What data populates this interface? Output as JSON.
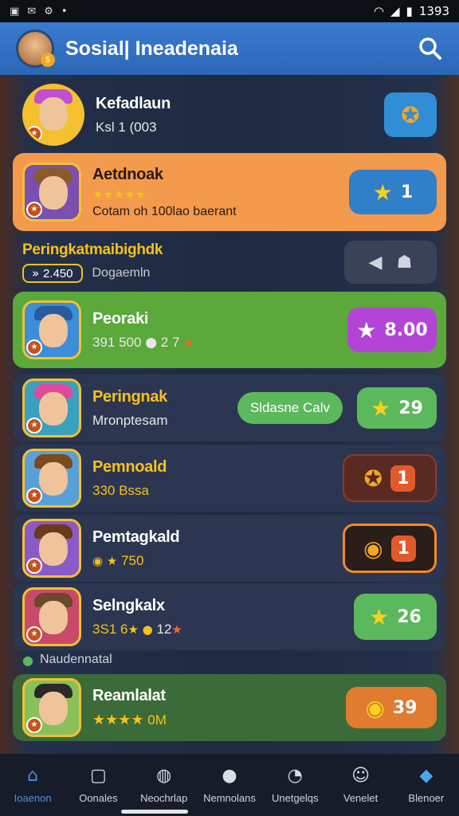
{
  "status_bar": {
    "time": "1393",
    "icons": [
      "image-icon",
      "mail-icon",
      "settings-icon",
      "dot-icon"
    ]
  },
  "header": {
    "title": "Sosial| Ineadenaia"
  },
  "profile": {
    "name": "Kefadlaun",
    "sub": "Ksl 1 (003"
  },
  "highlight": {
    "name": "Aetdnoak",
    "stars": "★★★★★",
    "sub": "Cotam oh 100lao baerant",
    "badge": "1",
    "colors": {
      "bg": "#f39a4d",
      "pill": "#2f7fc9"
    }
  },
  "section": {
    "title": "Peringkatmaibighdk",
    "score": "2.450",
    "sub": "Dogaemln"
  },
  "rows": [
    {
      "name": "Peoraki",
      "sub": "391 500",
      "extra": "2 7",
      "pill": "8.00",
      "bg": "#5aa93a",
      "pill_bg": "#b344d6"
    },
    {
      "name": "Peringnak",
      "sub": "Mronptesam",
      "tag": "Sldasne Calv",
      "pill": "29",
      "bg": "#2c3650",
      "pill_bg": "#5cb85c"
    },
    {
      "name": "Pemnoald",
      "sub": "330 Bssa",
      "pill": "1",
      "bg": "#2c3650",
      "pill_bg": "#5a2a22"
    },
    {
      "name": "Pemtagkald",
      "sub": "750",
      "pill": "1",
      "bg": "#2c3650",
      "pill_bg": "#2a1d1a"
    },
    {
      "name": "Selngkalx",
      "sub": "3S1 6",
      "extra": "12",
      "pill": "26",
      "bg": "#2c3650",
      "pill_bg": "#5cb85c"
    }
  ],
  "partial_row": {
    "text": "Naudennatal"
  },
  "last_row": {
    "name": "Reamlalat",
    "stars": "★★★★",
    "sub": "0M",
    "pill": "39",
    "bg": "#3c6b3a",
    "pill_bg": "#e07b30"
  },
  "nav": [
    {
      "label": "Ioaenon",
      "icon": "home-icon"
    },
    {
      "label": "Oonales",
      "icon": "square-icon"
    },
    {
      "label": "Neochrlap",
      "icon": "globe-icon"
    },
    {
      "label": "Nemnolans",
      "icon": "group-icon"
    },
    {
      "label": "Unetgelqs",
      "icon": "chat-icon"
    },
    {
      "label": "Venelet",
      "icon": "face-icon"
    },
    {
      "label": "Blenoer",
      "icon": "chat-bubble-icon"
    }
  ]
}
